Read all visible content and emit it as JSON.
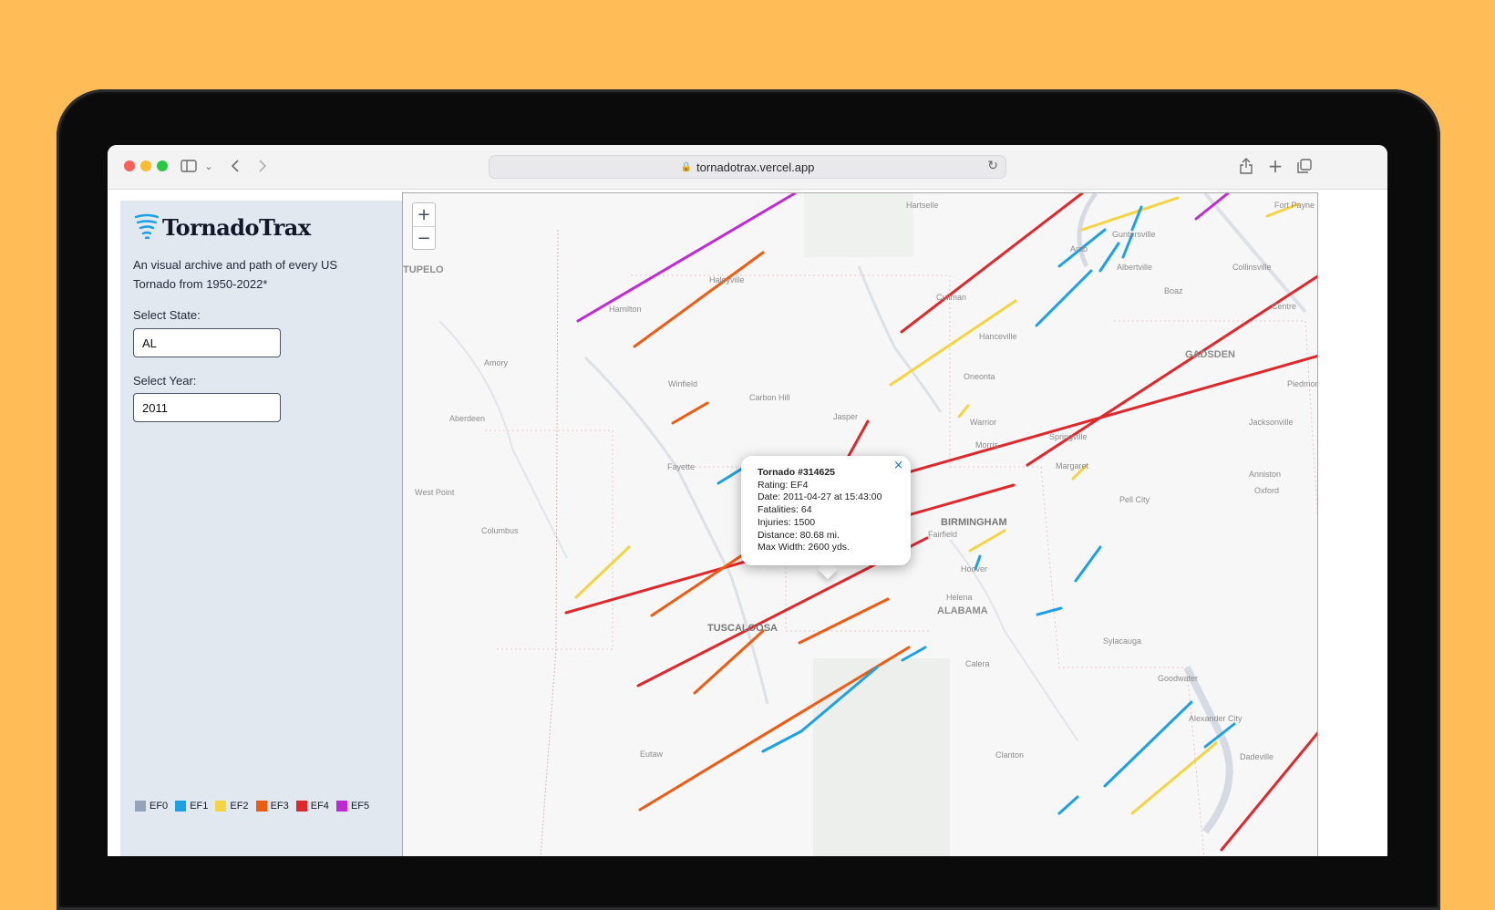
{
  "browser": {
    "url": "tornadotrax.vercel.app"
  },
  "app": {
    "title": "TornadoTrax",
    "description": "An visual archive and path of every US Tornado from 1950-2022*",
    "state": {
      "label": "Select State:",
      "value": "AL"
    },
    "year": {
      "label": "Select Year:",
      "value": "2011"
    }
  },
  "legend": [
    {
      "label": "EF0",
      "color": "#94a3b8"
    },
    {
      "label": "EF1",
      "color": "#1ca0e6"
    },
    {
      "label": "EF2",
      "color": "#f5d342"
    },
    {
      "label": "EF3",
      "color": "#f15a11"
    },
    {
      "label": "EF4",
      "color": "#e0272c"
    },
    {
      "label": "EF5",
      "color": "#c02ad6"
    }
  ],
  "map": {
    "zoom_in": "+",
    "zoom_out": "−",
    "city_labels": [
      "TUPELO",
      "Hamilton",
      "Haleyville",
      "Hartselle",
      "Cullman",
      "Arab",
      "Guntersville",
      "Albertville",
      "Boaz",
      "Fort Payne",
      "Collinsville",
      "Centre",
      "GADSDEN",
      "Piedmont",
      "Oneonta",
      "Hanceville",
      "Amory",
      "Winfield",
      "Carbon Hill",
      "Jasper",
      "Warrior",
      "Morris",
      "Springville",
      "Jacksonville",
      "Aberdeen",
      "Fayette",
      "Margaret",
      "Anniston",
      "Oxford",
      "Pell City",
      "West Point",
      "Columbus",
      "BIRMINGHAM",
      "Fairfield",
      "Hoover",
      "Helena",
      "ALABAMA",
      "TUSCALOOSA",
      "Sylacauga",
      "Calera",
      "Goodwater",
      "Eutaw",
      "Clanton",
      "Alexander City",
      "Dadeville"
    ],
    "popup": {
      "close": "×",
      "title": "Tornado #314625",
      "rating": "Rating: EF4",
      "date": "Date: 2011-04-27 at 15:43:00",
      "fatalities": "Fatalities: 64",
      "injuries": "Injuries: 1500",
      "distance": "Distance: 80.68 mi.",
      "width": "Max Width: 2600 yds."
    }
  }
}
